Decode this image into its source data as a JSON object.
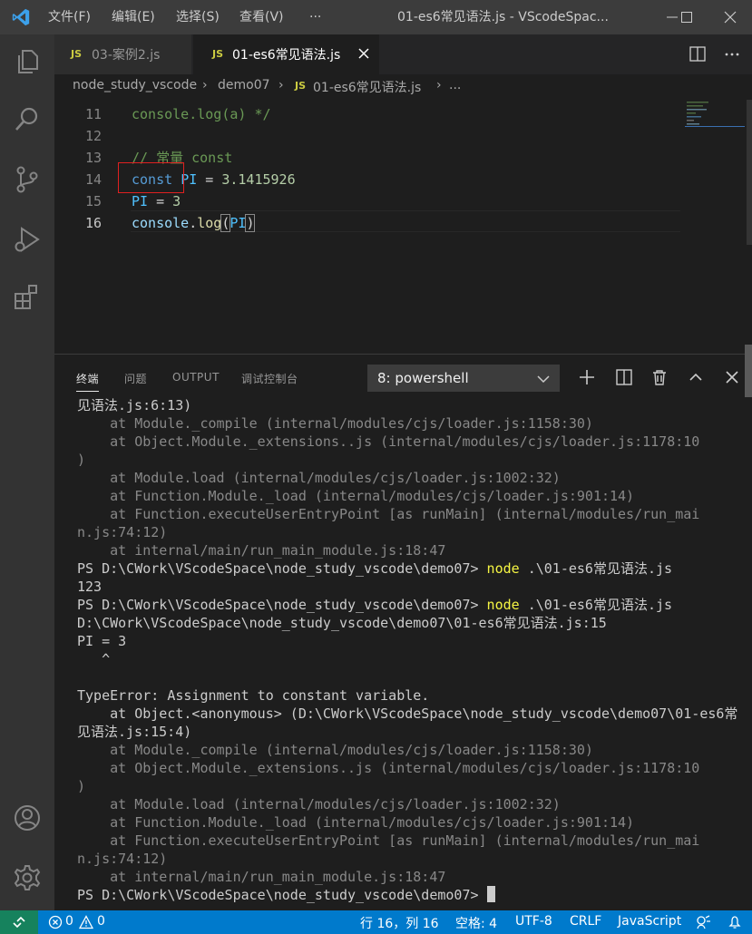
{
  "titlebar": {
    "menu": [
      "文件(F)",
      "编辑(E)",
      "选择(S)",
      "查看(V)",
      "···"
    ],
    "title": "01-es6常见语法.js - VScodeSpac..."
  },
  "tabs": [
    {
      "icon": "JS",
      "label": "03-案例2.js",
      "active": false
    },
    {
      "icon": "JS",
      "label": "01-es6常见语法.js",
      "active": true,
      "close": "✕"
    }
  ],
  "breadcrumb": {
    "parts": [
      "node_study_vscode",
      "demo07",
      "01-es6常见语法.js",
      "..."
    ],
    "separator": "›",
    "file_icon": "JS"
  },
  "editor": {
    "lines": [
      {
        "num": "11",
        "tokens": [
          {
            "t": "console.log(a) */",
            "c": "comment"
          }
        ]
      },
      {
        "num": "12",
        "tokens": []
      },
      {
        "num": "13",
        "tokens": [
          {
            "t": "// 常量 const",
            "c": "comment"
          }
        ]
      },
      {
        "num": "14",
        "tokens": [
          {
            "t": "const",
            "c": "kw"
          },
          {
            "t": " ",
            "c": "plain"
          },
          {
            "t": "PI",
            "c": "var"
          },
          {
            "t": " = ",
            "c": "plain"
          },
          {
            "t": "3.1415926",
            "c": "num"
          }
        ]
      },
      {
        "num": "15",
        "tokens": [
          {
            "t": "PI",
            "c": "var"
          },
          {
            "t": " = ",
            "c": "plain"
          },
          {
            "t": "3",
            "c": "num"
          }
        ]
      },
      {
        "num": "16",
        "tokens": [
          {
            "t": "console",
            "c": "var2"
          },
          {
            "t": ".",
            "c": "plain"
          },
          {
            "t": "log",
            "c": "fn"
          },
          {
            "t": "(",
            "c": "bracket"
          },
          {
            "t": "PI",
            "c": "var"
          },
          {
            "t": ")",
            "c": "bracket"
          }
        ]
      }
    ],
    "active_line": "16"
  },
  "panel": {
    "tabs": [
      "终端",
      "问题",
      "OUTPUT",
      "调试控制台"
    ],
    "active_tab": "终端",
    "terminal_select": "8: powershell"
  },
  "terminal": {
    "lines": [
      {
        "t": "见语法.js:6:13)"
      },
      {
        "t": "    at Module._compile (internal/modules/cjs/loader.js:1158:30)",
        "dim": true
      },
      {
        "t": "    at Object.Module._extensions..js (internal/modules/cjs/loader.js:1178:10",
        "dim": true
      },
      {
        "t": ")",
        "dim": true
      },
      {
        "t": "    at Module.load (internal/modules/cjs/loader.js:1002:32)",
        "dim": true
      },
      {
        "t": "    at Function.Module._load (internal/modules/cjs/loader.js:901:14)",
        "dim": true
      },
      {
        "t": "    at Function.executeUserEntryPoint [as runMain] (internal/modules/run_mai",
        "dim": true
      },
      {
        "t": "n.js:74:12)",
        "dim": true
      },
      {
        "t": "    at internal/main/run_main_module.js:18:47",
        "dim": true
      },
      {
        "t": "PS D:\\CWork\\VScodeSpace\\node_study_vscode\\demo07> ",
        "cmd": "node",
        "rest": " .\\01-es6常见语法.js"
      },
      {
        "t": "123"
      },
      {
        "t": "PS D:\\CWork\\VScodeSpace\\node_study_vscode\\demo07> ",
        "cmd": "node",
        "rest": " .\\01-es6常见语法.js"
      },
      {
        "t": "D:\\CWork\\VScodeSpace\\node_study_vscode\\demo07\\01-es6常见语法.js:15"
      },
      {
        "t": "PI = 3"
      },
      {
        "t": "   ^"
      },
      {
        "t": ""
      },
      {
        "t": "TypeError: Assignment to constant variable."
      },
      {
        "t": "    at Object.<anonymous> (D:\\CWork\\VScodeSpace\\node_study_vscode\\demo07\\01-es6常"
      },
      {
        "t": "见语法.js:15:4)"
      },
      {
        "t": "    at Module._compile (internal/modules/cjs/loader.js:1158:30)",
        "dim": true
      },
      {
        "t": "    at Object.Module._extensions..js (internal/modules/cjs/loader.js:1178:10",
        "dim": true
      },
      {
        "t": ")",
        "dim": true
      },
      {
        "t": "    at Module.load (internal/modules/cjs/loader.js:1002:32)",
        "dim": true
      },
      {
        "t": "    at Function.Module._load (internal/modules/cjs/loader.js:901:14)",
        "dim": true
      },
      {
        "t": "    at Function.executeUserEntryPoint [as runMain] (internal/modules/run_mai",
        "dim": true
      },
      {
        "t": "n.js:74:12)",
        "dim": true
      },
      {
        "t": "    at internal/main/run_main_module.js:18:47",
        "dim": true
      },
      {
        "t": "PS D:\\CWork\\VScodeSpace\\node_study_vscode\\demo07> ",
        "cursor": true
      }
    ]
  },
  "statusbar": {
    "errors": "0",
    "warnings": "0",
    "position": "行 16，列 16",
    "spaces": "空格: 4",
    "encoding": "UTF-8",
    "eol": "CRLF",
    "language": "JavaScript"
  },
  "colors": {
    "accent": "#007acc",
    "annotation": "#e02020",
    "js_icon": "#cbcb41"
  }
}
